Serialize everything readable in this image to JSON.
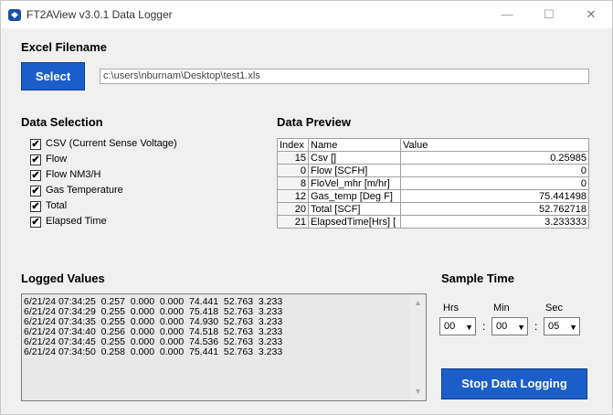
{
  "window": {
    "title": "FT2AView v3.0.1 Data Logger",
    "min": "—",
    "max": "☐",
    "close": "✕"
  },
  "excel": {
    "heading": "Excel Filename",
    "select_label": "Select",
    "path": "c:\\users\\nburnam\\Desktop\\test1.xls"
  },
  "selection": {
    "heading": "Data Selection",
    "items": [
      {
        "label": "CSV (Current Sense Voltage)",
        "checked": "✔"
      },
      {
        "label": "Flow",
        "checked": "✔"
      },
      {
        "label": "Flow NM3/H",
        "checked": "✔"
      },
      {
        "label": "Gas Temperature",
        "checked": "✔"
      },
      {
        "label": "Total",
        "checked": "✔"
      },
      {
        "label": "Elapsed Time",
        "checked": "✔"
      }
    ]
  },
  "preview": {
    "heading": "Data Preview",
    "columns": [
      "Index",
      "Name",
      "Value"
    ],
    "rows": [
      {
        "index": "15",
        "name": "Csv []",
        "value": "0.25985"
      },
      {
        "index": "0",
        "name": "Flow [SCFH]",
        "value": "0"
      },
      {
        "index": "8",
        "name": "FloVel_mhr [m/hr]",
        "value": "0"
      },
      {
        "index": "12",
        "name": "Gas_temp [Deg F]",
        "value": "75.441498"
      },
      {
        "index": "20",
        "name": "Total [SCF]",
        "value": "52.762718"
      },
      {
        "index": "21",
        "name": "ElapsedTime[Hrs] [",
        "value": "3.233333"
      }
    ]
  },
  "log": {
    "heading": "Logged Values",
    "lines": [
      "6/21/24 07:34:25  0.257  0.000  0.000  74.441  52.763  3.233",
      "6/21/24 07:34:29  0.255  0.000  0.000  75.418  52.763  3.233",
      "6/21/24 07:34:35  0.255  0.000  0.000  74.930  52.763  3.233",
      "6/21/24 07:34:40  0.256  0.000  0.000  74.518  52.763  3.233",
      "6/21/24 07:34:45  0.255  0.000  0.000  74.536  52.763  3.233",
      "6/21/24 07:34:50  0.258  0.000  0.000  75.441  52.763  3.233"
    ]
  },
  "sample": {
    "heading": "Sample Time",
    "hrs_label": "Hrs",
    "min_label": "Min",
    "sec_label": "Sec",
    "hrs": "00",
    "min": "00",
    "sec": "05",
    "sep": ":"
  },
  "stop_label": "Stop Data Logging",
  "colors": {
    "accent": "#1b5ec9"
  }
}
